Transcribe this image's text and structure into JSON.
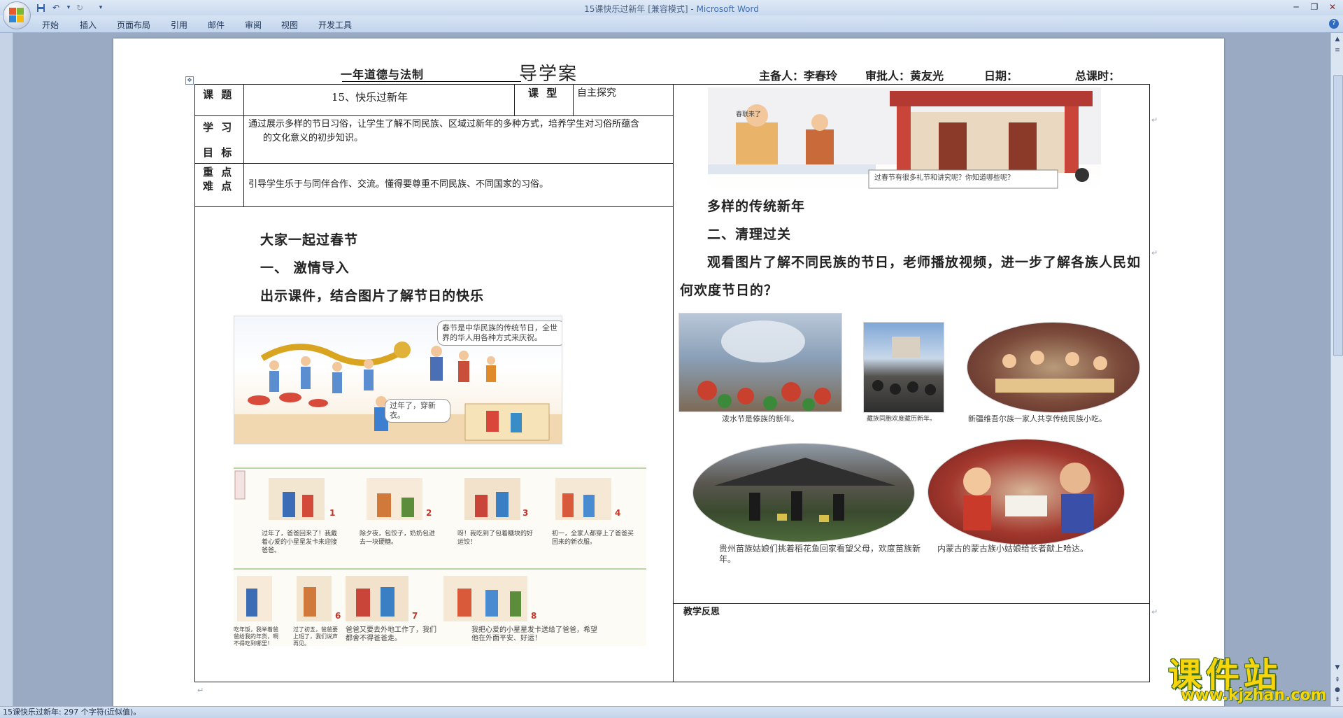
{
  "window": {
    "title": "15课快乐过新年 [兼容模式]",
    "app_name": "Microsoft Word",
    "title_separator": " - "
  },
  "ribbon": {
    "tabs": [
      "开始",
      "插入",
      "页面布局",
      "引用",
      "邮件",
      "审阅",
      "视图",
      "开发工具"
    ]
  },
  "doc": {
    "header": {
      "subject": "一年道德与法制",
      "doc_type": "导学案",
      "preparer": "主备人：李春玲",
      "approver": "审批人：黄友光",
      "date": "日期：",
      "total_hours": "总课时："
    },
    "info_table": {
      "topic_label": "课 题",
      "topic_value": "15、快乐过新年",
      "type_label": "课 型",
      "type_value": "自主探究",
      "goal_label_1": "学 习",
      "goal_label_2": "目 标",
      "goal_text_1": "通过展示多样的节日习俗，让学生了解不同民族、区域过新年的多种方式，培养学生对习俗所蕴含",
      "goal_text_2": "的文化意义的初步知识。",
      "key_label_1": "重 点",
      "key_label_2": "难 点",
      "key_text": "引导学生乐于与同伴合作、交流。懂得要尊重不同民族、不同国家的习俗。"
    },
    "left_column": {
      "heading": "大家一起过春节",
      "section_1": "一、 激情导入",
      "instruction": "出示课件，结合图片了解节日的快乐",
      "comic_bubble_1": "春节是中华民族的传统节日，全世界的华人用各种方式来庆祝。",
      "comic_bubble_2": "过年了，穿新衣。",
      "strip_captions": [
        "过年了，爸爸回来了！我戴着心爱的小星星发卡来迎接爸爸。",
        "除夕夜，包饺子，奶奶包进去一块硬糖。",
        "呀！我吃到了包着糖块的好运饺！",
        "初一，全家人都穿上了爸爸买回来的新衣服。",
        "吃年饭，我举着爸爸给我的年货，啊不得吃到哪里！",
        "过了初五，爸爸要上班了，我们说声再见。",
        "爸爸又要去外地工作了，我们都舍不得爸爸走。",
        "我把心爱的小星星发卡送给了爸爸，希望他在外面平安、好运！"
      ],
      "strip_numbers": [
        "1",
        "2",
        "3",
        "4",
        "6",
        "7",
        "8"
      ]
    },
    "right_column": {
      "top_image_caption": "过春节有很多礼节和讲究呢？你知道哪些呢？",
      "top_image_sign": "春联来了",
      "heading_diverse": "多样的传统新年",
      "section_2": "二、清理过关",
      "paragraph": "观看图片了解不同民族的节日，老师播放视频，进一步了解各族人民如",
      "paragraph_cont": "何欢度节日的？",
      "photo_captions": [
        "泼水节是傣族的新年。",
        "藏族同胞欢度藏历新年。",
        "新疆维吾尔族一家人共享传统民族小吃。",
        "贵州苗族姑娘们挑着稻花鱼回家看望父母，欢度苗族新年。",
        "内蒙古的蒙古族小姑娘给长者献上哈达。"
      ],
      "reflection_label": "教学反思"
    }
  },
  "statusbar": {
    "text": "15课快乐过新年: 297 个字符(近似值)。"
  },
  "watermark": {
    "title": "课件站",
    "url": "www.kjzhan.com"
  },
  "colors": {
    "titlebar_accent": "#3e6fb5",
    "watermark_yellow": "#f6d50c",
    "watermark_outline": "#3a6b1f"
  }
}
